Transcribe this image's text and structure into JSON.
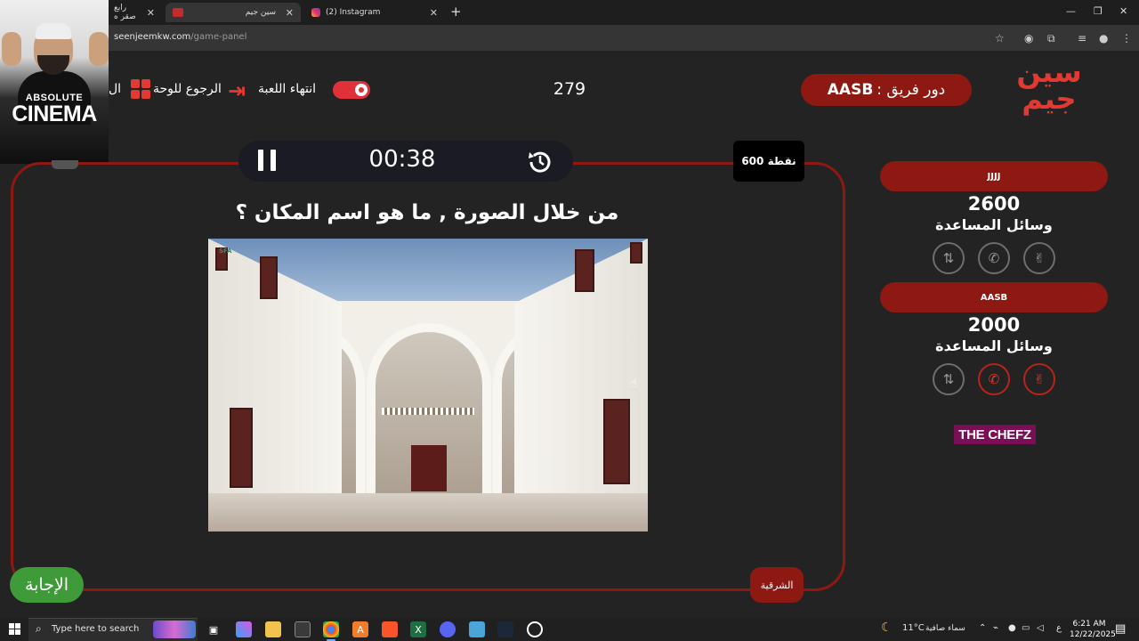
{
  "browser": {
    "tabs": [
      {
        "title": "رابع صقر ه",
        "active": false
      },
      {
        "title": "سين جيم",
        "active": true
      },
      {
        "title": "(2) Instagram",
        "active": false
      }
    ],
    "new_tab": "+",
    "url_host": "seenjeemkw.com",
    "url_path": "/game-panel"
  },
  "webcam": {
    "line1": "ABSOLUTE",
    "line2": "CINEMA"
  },
  "header": {
    "logo_text": "سين جيم",
    "turn_prefix": "دور فريق :",
    "turn_team": "AASB",
    "counter": "279",
    "end_game_label": "انتهاء اللعبة",
    "back_label": "الرجوع للوحة",
    "cut_label": "ال"
  },
  "question": {
    "timer": "00:38",
    "points": "600 نقطة",
    "text": "من خلال الصورة , ما هو اسم المكان ؟",
    "category": "الشرقية",
    "answer_button": "الإجابة",
    "photo_watermark": "SFA"
  },
  "teams": [
    {
      "name": "JJJJ",
      "score": "2600",
      "aids_label": "وسائل المساعدة",
      "aids": [
        {
          "icon": "swap-icon",
          "used": false
        },
        {
          "icon": "phone-icon",
          "used": false
        },
        {
          "icon": "two-answers-icon",
          "used": false
        }
      ]
    },
    {
      "name": "AASB",
      "score": "2000",
      "aids_label": "وسائل المساعدة",
      "aids": [
        {
          "icon": "swap-icon",
          "used": false
        },
        {
          "icon": "phone-icon",
          "used": true
        },
        {
          "icon": "two-answers-icon",
          "used": true
        }
      ]
    }
  ],
  "sponsor": "THE CHEFZ",
  "taskbar": {
    "search_placeholder": "Type here to search",
    "temperature": "11°C",
    "weather": "سماء صافية",
    "lang": "ع",
    "time": "6:21 AM",
    "date": "12/22/2025"
  },
  "colors": {
    "brand_red": "#8e1812",
    "accent_red": "#e03a33",
    "answer_green": "#3f9a3a",
    "background": "#232323"
  }
}
